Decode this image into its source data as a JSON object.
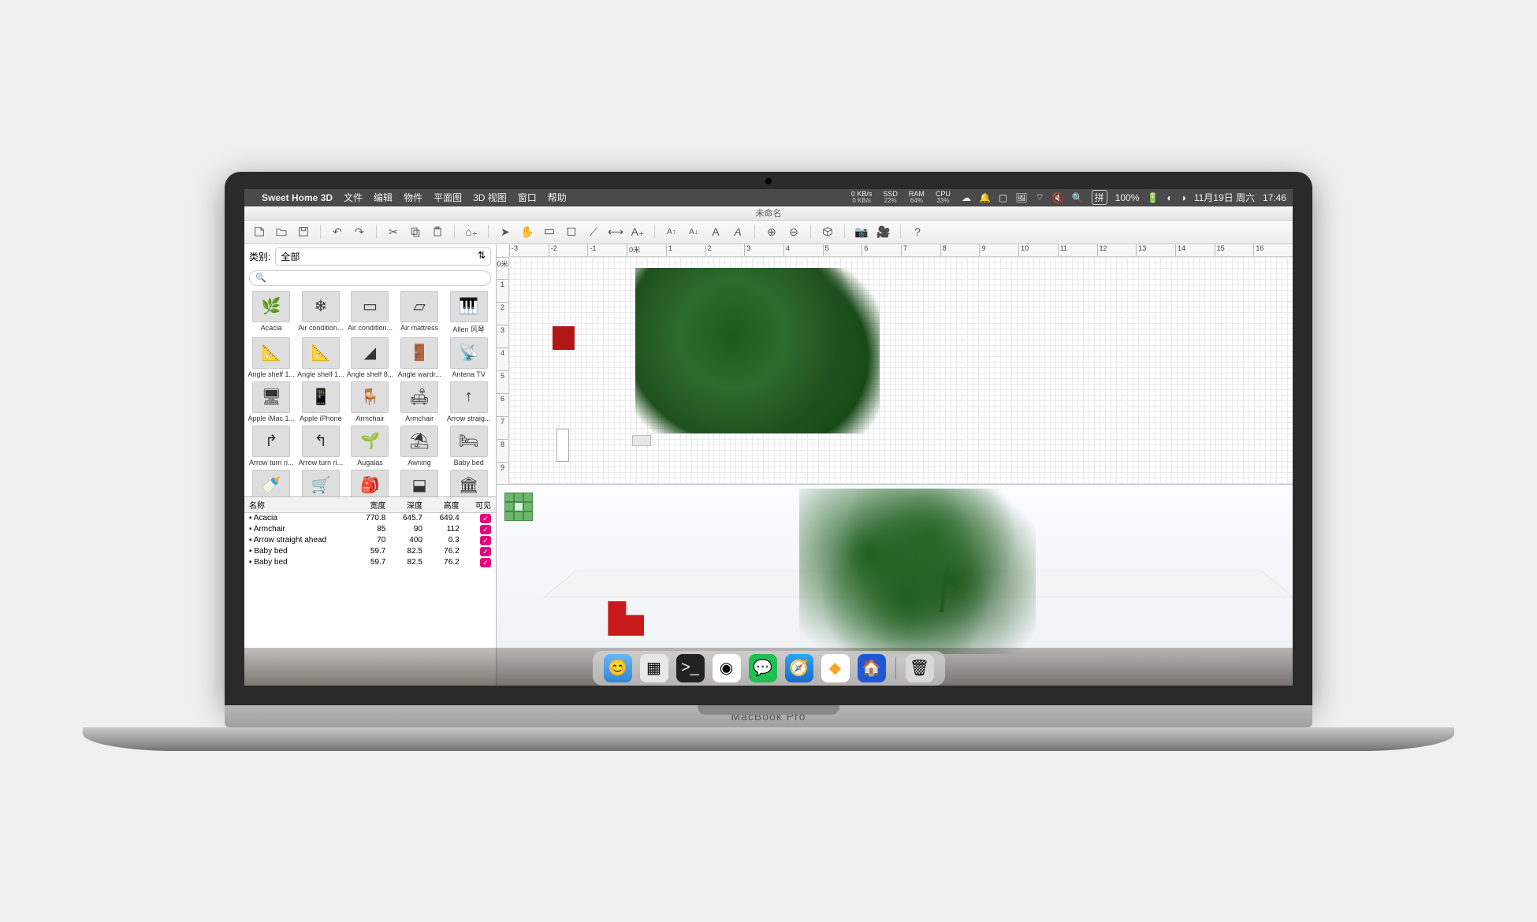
{
  "menubar": {
    "app": "Sweet Home 3D",
    "items": [
      "文件",
      "编辑",
      "物件",
      "平面图",
      "3D 视图",
      "窗口",
      "帮助"
    ],
    "stats": [
      {
        "v": "0 KB/s",
        "l": "0 KB/s"
      },
      {
        "v": "SSD",
        "l": "22%"
      },
      {
        "v": "RAM",
        "l": "64%"
      },
      {
        "v": "CPU",
        "l": "33%"
      }
    ],
    "ime": "拼",
    "battery": "100%",
    "date": "11月19日 周六",
    "time": "17:46"
  },
  "window": {
    "title": "未命名"
  },
  "toolbar": {
    "groups": [
      [
        "new-doc",
        "open-doc",
        "save-doc"
      ],
      [
        "undo",
        "redo"
      ],
      [
        "cut",
        "copy",
        "paste"
      ],
      [
        "add-furniture"
      ],
      [
        "pointer",
        "pan",
        "wall",
        "room",
        "polyline",
        "dimension",
        "text"
      ],
      [
        "text-inc",
        "text-dec",
        "text-normal",
        "text-italic"
      ],
      [
        "zoom-in",
        "zoom-out"
      ],
      [
        "view3d"
      ],
      [
        "photo",
        "video"
      ],
      [
        "help"
      ]
    ]
  },
  "catalog": {
    "label": "类别:",
    "selected": "全部",
    "search_placeholder": "",
    "items": [
      {
        "n": "Acacia",
        "e": "🌿"
      },
      {
        "n": "Air condition...",
        "e": "❄"
      },
      {
        "n": "Air condition...",
        "e": "▭"
      },
      {
        "n": "Air mattress",
        "e": "▱"
      },
      {
        "n": "Allen 风琴",
        "e": "🎹"
      },
      {
        "n": "Angle shelf 1...",
        "e": "📐"
      },
      {
        "n": "Angle shelf 1...",
        "e": "📐"
      },
      {
        "n": "Angle shelf 8...",
        "e": "◢"
      },
      {
        "n": "Angle wardr...",
        "e": "🚪"
      },
      {
        "n": "Antena TV",
        "e": "📡"
      },
      {
        "n": "Apple iMac 1...",
        "e": "🖥"
      },
      {
        "n": "Apple iPhone",
        "e": "📱"
      },
      {
        "n": "Armchair",
        "e": "🪑"
      },
      {
        "n": "Armchair",
        "e": "🛋"
      },
      {
        "n": "Arrow straig...",
        "e": "↑"
      },
      {
        "n": "Arrow turn ri...",
        "e": "↱"
      },
      {
        "n": "Arrow turn ri...",
        "e": "↰"
      },
      {
        "n": "Augalas",
        "e": "🌱"
      },
      {
        "n": "Awning",
        "e": "⛱"
      },
      {
        "n": "Baby bed",
        "e": "🛏"
      },
      {
        "n": "",
        "e": "🍼"
      },
      {
        "n": "",
        "e": "🛒"
      },
      {
        "n": "",
        "e": "🎒"
      },
      {
        "n": "",
        "e": "⬓"
      },
      {
        "n": "",
        "e": "🏛"
      }
    ]
  },
  "furniture_table": {
    "headers": [
      "名称",
      "宽度",
      "深度",
      "高度",
      "可见"
    ],
    "rows": [
      {
        "name": "Acacia",
        "w": "770.8",
        "d": "645.7",
        "h": "649.4",
        "v": true
      },
      {
        "name": "Armchair",
        "w": "85",
        "d": "90",
        "h": "112",
        "v": true
      },
      {
        "name": "Arrow straight ahead",
        "w": "70",
        "d": "400",
        "h": "0.3",
        "v": true
      },
      {
        "name": "Baby bed",
        "w": "59.7",
        "d": "82.5",
        "h": "76.2",
        "v": true
      },
      {
        "name": "Baby bed",
        "w": "59.7",
        "d": "82.5",
        "h": "76.2",
        "v": true
      }
    ]
  },
  "ruler": {
    "top": [
      "-3",
      "-2",
      "-1",
      "0米",
      "1",
      "2",
      "3",
      "4",
      "5",
      "6",
      "7",
      "8",
      "9",
      "10",
      "11",
      "12",
      "13",
      "14",
      "15",
      "16"
    ],
    "left": [
      "0米",
      "1",
      "2",
      "3",
      "4",
      "5",
      "6",
      "7",
      "8",
      "9"
    ]
  },
  "laptop_brand": "MacBook Pro",
  "dock": [
    "finder",
    "launchpad",
    "terminal",
    "chrome",
    "wechat",
    "safari",
    "sketch",
    "sh3d",
    "trash"
  ]
}
